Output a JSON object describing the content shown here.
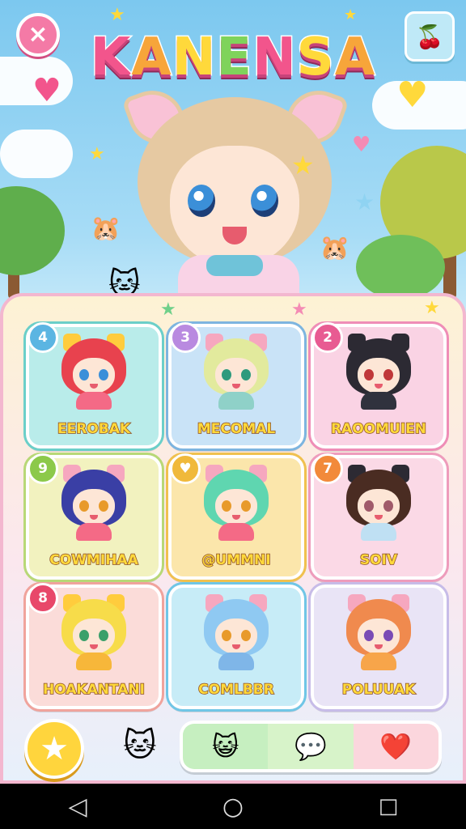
{
  "title": {
    "letters": [
      "K",
      "A",
      "N",
      "E",
      "N",
      "S",
      "A"
    ],
    "colors": [
      "#f2558c",
      "#f7a53a",
      "#ffd93b",
      "#7fd35b",
      "#f2558c",
      "#ffd93b",
      "#f7a53a"
    ]
  },
  "top": {
    "close_icon": "×",
    "menu_icon": "🍒"
  },
  "characters": [
    {
      "badge": "4",
      "name": "EEROBAK",
      "bg": "#b9ecea",
      "border": "#6bcfc9",
      "badge_color": "#5bb5e2",
      "hair": "#e8424e",
      "eyes": "#3a8fd9",
      "outfit": "#f46a86",
      "ears": "#ffcc3d"
    },
    {
      "badge": "3",
      "name": "MECOMAL",
      "bg": "#c9e3f7",
      "border": "#7db5e0",
      "badge_color": "#b98ae0",
      "hair": "#e2ea9d",
      "eyes": "#2e9a7d",
      "outfit": "#8fd1c8",
      "ears": "#f6a7bf"
    },
    {
      "badge": "2",
      "name": "RAOOMUIEN",
      "bg": "#fad3e4",
      "border": "#ef8db7",
      "badge_color": "#e85b92",
      "hair": "#2c2a33",
      "eyes": "#c0383a",
      "outfit": "#30323d",
      "ears": "#2c2a33"
    },
    {
      "badge": "9",
      "name": "COWMIHAA",
      "bg": "#f2f2bf",
      "border": "#b8d877",
      "badge_color": "#8cc94a",
      "hair": "#3a3fa5",
      "eyes": "#e89a2a",
      "outfit": "#f46a86",
      "ears": "#f6a7bf"
    },
    {
      "badge": "♥",
      "name": "@UMMNI",
      "bg": "#fbe6ab",
      "border": "#f0c14f",
      "badge_color": "#f0b93b",
      "hair": "#5fd6b0",
      "eyes": "#e89a2a",
      "outfit": "#f46a86",
      "ears": "#f6a7bf"
    },
    {
      "badge": "7",
      "name": "SOIV",
      "bg": "#fbd9e6",
      "border": "#ee9cbc",
      "badge_color": "#f28a3a",
      "hair": "#4a2c22",
      "eyes": "#a05a6a",
      "outfit": "#bfe0f3",
      "ears": "#2c2a33"
    },
    {
      "badge": "8",
      "name": "HOAKANTANI",
      "bg": "#fbdcd9",
      "border": "#f0a39c",
      "badge_color": "#e8486a",
      "hair": "#f7dc4a",
      "eyes": "#3aa06a",
      "outfit": "#f7b73a",
      "ears": "#ffcc3d"
    },
    {
      "badge": "",
      "name": "COMLBBR",
      "bg": "#c7ecf7",
      "border": "#70c6e6",
      "badge_color": "#70c6e6",
      "hair": "#8fc9f2",
      "eyes": "#e89a2a",
      "outfit": "#7fb6e8",
      "ears": "#f6a7bf"
    },
    {
      "badge": "",
      "name": "POLUUAK",
      "bg": "#e9e4f6",
      "border": "#c7bce8",
      "badge_color": "#c7bce8",
      "hair": "#f08a4e",
      "eyes": "#7a4bb5",
      "outfit": "#f7a54a",
      "ears": "#f6a7bf"
    }
  ],
  "bottom": {
    "star_icon": "★",
    "mascot_icon": "🐱",
    "tabs": [
      "😺",
      "💬",
      "❤️"
    ]
  },
  "nav": {
    "back_icon": "◁",
    "home_icon": "○",
    "recents_icon": "□"
  }
}
